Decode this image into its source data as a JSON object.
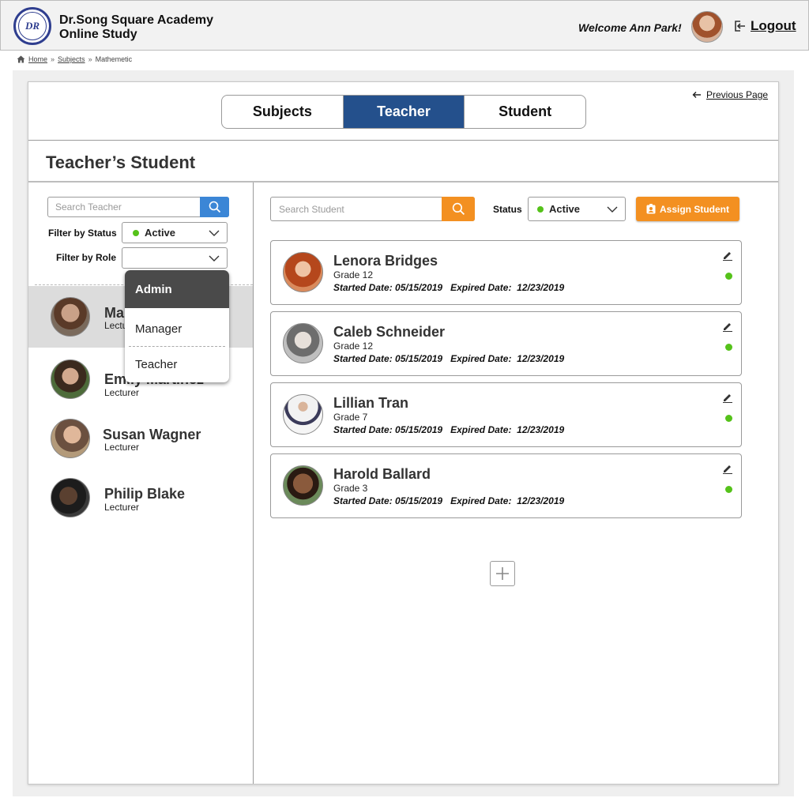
{
  "header": {
    "logo_text": "DR",
    "brand_line1": "Dr.Song Square Academy",
    "brand_line2": "Online Study",
    "welcome": "Welcome Ann Park!",
    "logout_label": "Logout"
  },
  "breadcrumb": {
    "items": [
      "Home",
      "Subjects",
      "Mathemetic"
    ]
  },
  "tabs": {
    "items": [
      {
        "label": "Subjects",
        "active": false
      },
      {
        "label": "Teacher",
        "active": true
      },
      {
        "label": "Student",
        "active": false
      }
    ]
  },
  "previous_page_label": "Previous Page",
  "page_title": "Teacher’s Student",
  "left_panel": {
    "search_placeholder": "Search Teacher",
    "filter_status_label": "Filter by Status",
    "filter_status_value": "Active",
    "filter_role_label": "Filter by Role",
    "filter_role_value": "",
    "role_options": [
      "Admin",
      "Manager",
      "Teacher"
    ],
    "role_highlighted": "Admin",
    "teachers": [
      {
        "name": "Marcus Fields",
        "role": "Lecturer",
        "selected": true
      },
      {
        "name": "Emily Martinez",
        "role": "Lecturer",
        "selected": false
      },
      {
        "name": "Susan Wagner",
        "role": "Lecturer",
        "selected": false
      },
      {
        "name": "Philip Blake",
        "role": "Lecturer",
        "selected": false
      }
    ]
  },
  "right_panel": {
    "search_placeholder": "Search Student",
    "status_label": "Status",
    "status_value": "Active",
    "assign_button": "Assign Student",
    "started_label": "Started Date:",
    "expired_label": "Expired Date:",
    "students": [
      {
        "name": "Lenora Bridges",
        "grade": "Grade 12",
        "started": "05/15/2019",
        "expired": "12/23/2019",
        "status": "active"
      },
      {
        "name": "Caleb Schneider",
        "grade": "Grade 12",
        "started": "05/15/2019",
        "expired": "12/23/2019",
        "status": "active"
      },
      {
        "name": "Lillian Tran",
        "grade": "Grade 7",
        "started": "05/15/2019",
        "expired": "12/23/2019",
        "status": "active"
      },
      {
        "name": "Harold Ballard",
        "grade": "Grade 3",
        "started": "05/15/2019",
        "expired": "12/23/2019",
        "status": "active"
      }
    ]
  },
  "colors": {
    "tab_active": "#24508c",
    "accent_orange": "#f39021",
    "accent_blue": "#3b86d6",
    "status_green": "#55c21a"
  }
}
